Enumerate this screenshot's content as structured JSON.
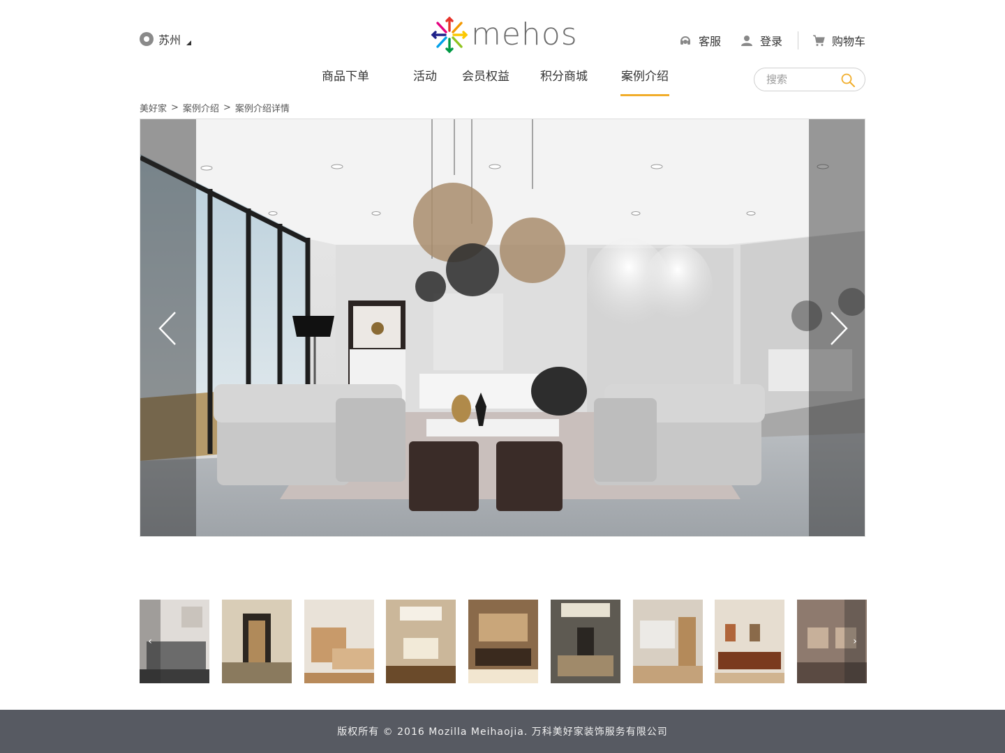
{
  "header": {
    "city": "苏州",
    "logo_text": "mehos",
    "service_label": "客服",
    "login_label": "登录",
    "cart_label": "购物车"
  },
  "nav": {
    "items": [
      {
        "label": "商品下单"
      },
      {
        "label": "活动"
      },
      {
        "label": "会员权益"
      },
      {
        "label": "积分商城"
      },
      {
        "label": "案例介绍",
        "active": true
      }
    ],
    "search_placeholder": "搜索"
  },
  "breadcrumb": {
    "items": [
      "美好家",
      "案例介绍",
      "案例介绍详情"
    ],
    "separator": ">"
  },
  "gallery": {
    "prev_label": "‹",
    "next_label": "›",
    "thumbnail_count": 9
  },
  "footer": {
    "copyright": "版权所有 © 2016 Mozilla Meihaojia. 万科美好家装饰服务有限公司"
  },
  "colors": {
    "accent": "#f1ad2a",
    "footer_bg": "#575a62"
  }
}
